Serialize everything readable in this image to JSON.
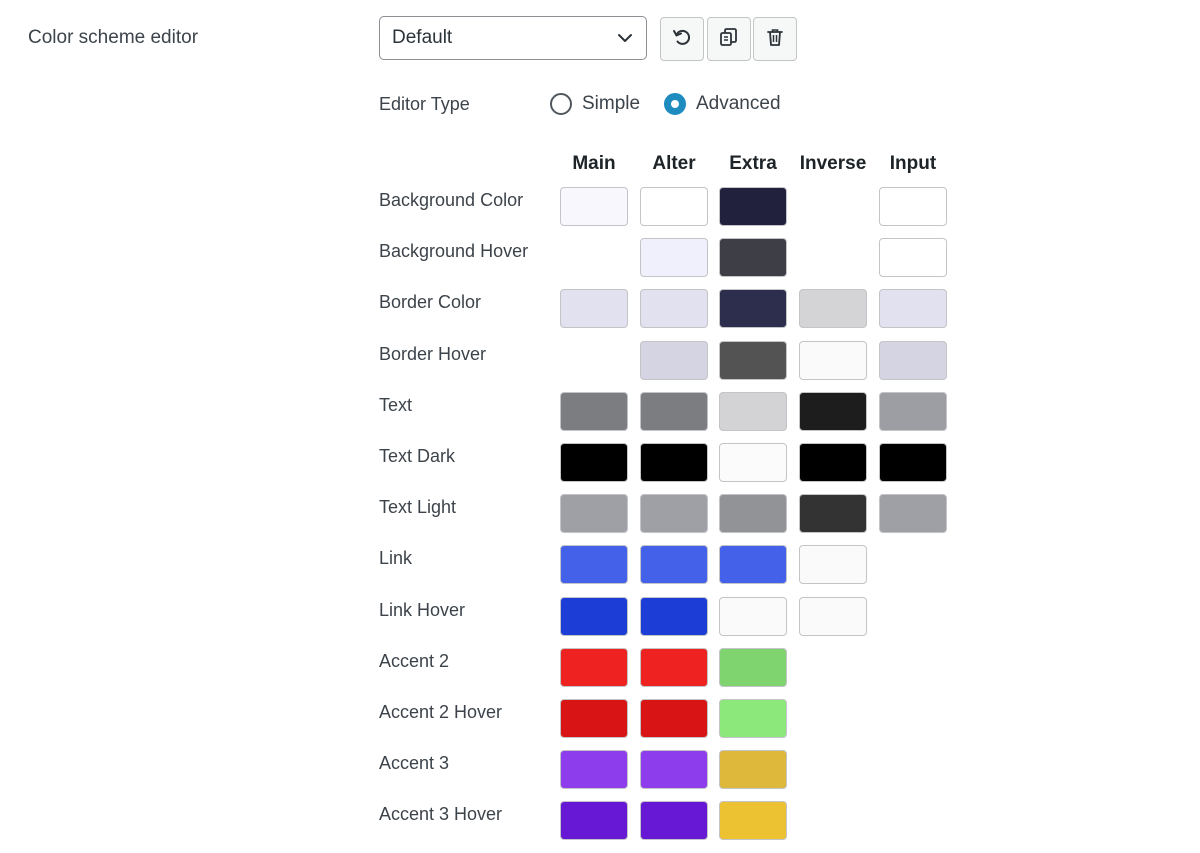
{
  "section": {
    "title": "Color scheme editor"
  },
  "scheme": {
    "selected": "Default"
  },
  "toolbar": {
    "reset_icon": "reset-icon",
    "copy_icon": "copy-icon",
    "delete_icon": "trash-icon"
  },
  "editor_type": {
    "label": "Editor Type",
    "options": [
      {
        "label": "Simple",
        "checked": false
      },
      {
        "label": "Advanced",
        "checked": true
      }
    ],
    "accent_color": "#1e8cbe"
  },
  "columns": [
    "Main",
    "Alter",
    "Extra",
    "Inverse",
    "Input"
  ],
  "rows": [
    {
      "label": "Background Color",
      "colors": [
        "#f7f7fd",
        "#ffffff",
        "#21213d",
        null,
        "#ffffff"
      ]
    },
    {
      "label": "Background Hover",
      "colors": [
        null,
        "#f0f0fc",
        "#3e3e47",
        null,
        "#ffffff"
      ]
    },
    {
      "label": "Border Color",
      "colors": [
        "#e1e1f0",
        "#e1e1f0",
        "#2d2d4d",
        "#d4d4d6",
        "#e1e1f0"
      ]
    },
    {
      "label": "Border Hover",
      "colors": [
        null,
        "#d4d4e3",
        "#535353",
        "#fafafa",
        "#d4d4e3"
      ]
    },
    {
      "label": "Text",
      "colors": [
        "#7b7d80",
        "#7b7d80",
        "#d3d3d5",
        "#1d1d1d",
        "#9d9ea3"
      ]
    },
    {
      "label": "Text Dark",
      "colors": [
        "#000000",
        "#000000",
        "#fbfbfb",
        "#000000",
        "#000000"
      ]
    },
    {
      "label": "Text Light",
      "colors": [
        "#9fa0a6",
        "#9fa0a6",
        "#929397",
        "#333333",
        "#9fa0a6"
      ]
    },
    {
      "label": "Link",
      "colors": [
        "#4461ea",
        "#4461ea",
        "#4461ea",
        "#fafafa",
        null
      ]
    },
    {
      "label": "Link Hover",
      "colors": [
        "#1d3ed6",
        "#1d3ed6",
        "#fafafa",
        "#fafafa",
        null
      ]
    },
    {
      "label": "Accent 2",
      "colors": [
        "#ef2222",
        "#ef2222",
        "#7fd46f",
        null,
        null
      ]
    },
    {
      "label": "Accent 2 Hover",
      "colors": [
        "#d91414",
        "#d91414",
        "#8ce87a",
        null,
        null
      ]
    },
    {
      "label": "Accent 3",
      "colors": [
        "#8e3ded",
        "#8e3ded",
        "#deb83b",
        null,
        null
      ]
    },
    {
      "label": "Accent 3 Hover",
      "colors": [
        "#6718d4",
        "#6718d4",
        "#ecc232",
        null,
        null
      ]
    }
  ]
}
